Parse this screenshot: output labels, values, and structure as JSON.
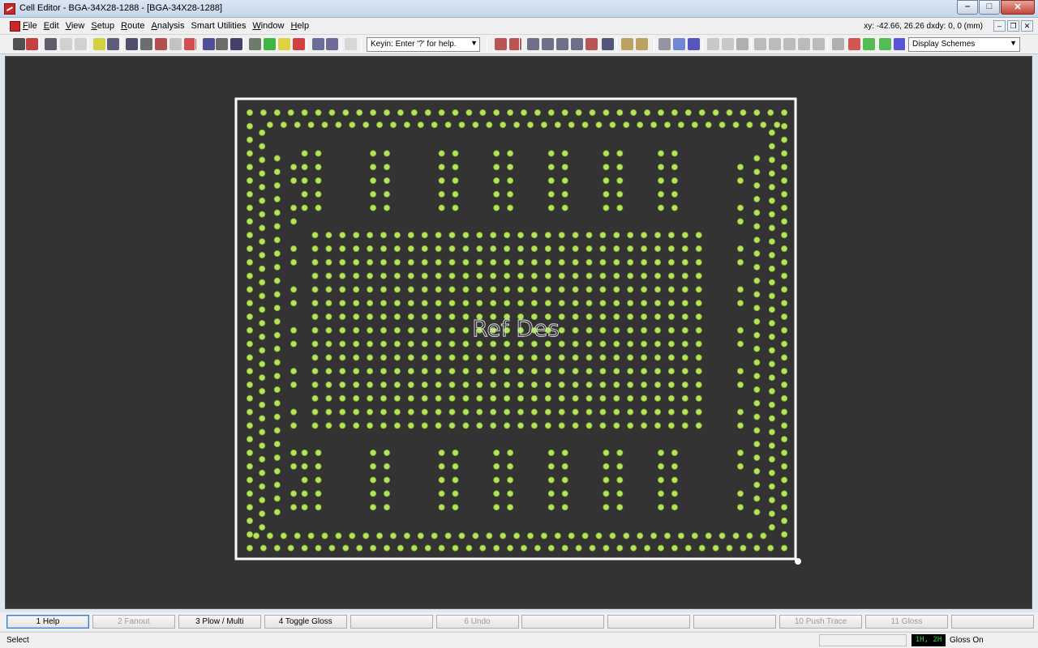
{
  "window": {
    "title": "Cell Editor - BGA-34X28-1288 - [BGA-34X28-1288]",
    "controls": [
      "minimize-icon",
      "maximize-icon",
      "close-icon"
    ]
  },
  "menu": {
    "items": [
      {
        "first": "F",
        "rest": "ile"
      },
      {
        "first": "E",
        "rest": "dit"
      },
      {
        "first": "V",
        "rest": "iew"
      },
      {
        "first": "S",
        "rest": "etup"
      },
      {
        "first": "R",
        "rest": "oute"
      },
      {
        "first": "A",
        "rest": "nalysis"
      },
      {
        "first": "",
        "rest": "Smart Utilities"
      },
      {
        "first": "W",
        "rest": "indow"
      },
      {
        "first": "H",
        "rest": "elp"
      }
    ],
    "coords": "xy: -42.66, 26.26   dxdy: 0, 0  (mm)"
  },
  "toolbar": {
    "keyin_text": "Keyin: Enter '?' for help.",
    "display_schemes": "Display Schemes",
    "icons": [
      "save-icon",
      "exit-icon",
      "zoom-icon",
      "undo-icon",
      "redo-icon",
      "highlight-icon",
      "move-icon",
      "fit-board-icon",
      "select-icon",
      "prev-icon",
      "next-icon",
      "filter-icon",
      "layer-icon",
      "route-mode-icon",
      "place-icon",
      "setup-icon",
      "drc-ok-icon",
      "warning-icon",
      "drc-icon",
      "copy-icon",
      "paste-icon",
      "delete-icon"
    ]
  },
  "canvas": {
    "background": "#333333",
    "outline_color": "#ffffff",
    "pad_color": "#b5e35a",
    "ref_des": "Ref Des"
  },
  "fkeys": [
    {
      "label": "1 Help",
      "enabled": true
    },
    {
      "label": "2 Fanout",
      "enabled": false
    },
    {
      "label": "3 Plow / Multi",
      "enabled": true
    },
    {
      "label": "4 Toggle Gloss",
      "enabled": true
    },
    {
      "label": "",
      "enabled": false
    },
    {
      "label": "6 Undo",
      "enabled": false
    },
    {
      "label": "",
      "enabled": false
    },
    {
      "label": "",
      "enabled": false
    },
    {
      "label": "",
      "enabled": false
    },
    {
      "label": "10 Push Trace",
      "enabled": false
    },
    {
      "label": "11 Gloss",
      "enabled": false
    },
    {
      "label": "",
      "enabled": false
    }
  ],
  "status": {
    "text": "Select",
    "layer_indicator": "1H, 2H",
    "gloss": "Gloss On"
  }
}
